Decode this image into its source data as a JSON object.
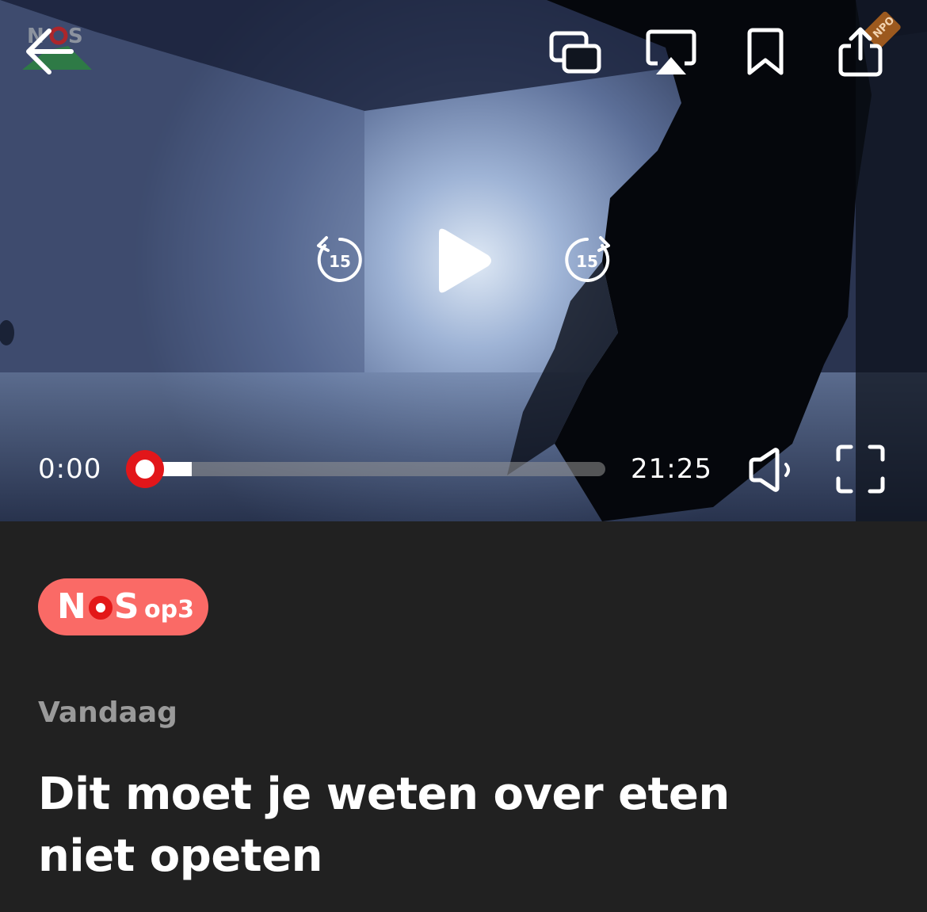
{
  "player": {
    "current_time": "0:00",
    "total_time": "21:25",
    "progress_fraction": 0.0,
    "buffered_fraction": 0.1,
    "skip_back_seconds": "15",
    "skip_forward_seconds": "15",
    "state": "paused",
    "watermark_text": "NOS",
    "corner_tag_text": "NPO",
    "icons": {
      "back": "arrow-left-icon",
      "cast": "picture-in-picture-icon",
      "airplay": "airplay-icon",
      "bookmark": "bookmark-icon",
      "share": "share-icon",
      "rewind": "rewind-15-icon",
      "play": "play-icon",
      "forward": "forward-15-icon",
      "volume": "volume-icon",
      "fullscreen": "fullscreen-icon"
    }
  },
  "badge": {
    "nos_n": "N",
    "nos_s": "S",
    "suffix": "op3"
  },
  "article": {
    "category": "Vandaag",
    "title": "Dit moet je weten over eten niet opeten"
  },
  "colors": {
    "background": "#212121",
    "badge_bg": "#fa6a66",
    "accent_red": "#e2161a",
    "category_text": "#9a9a9a"
  }
}
